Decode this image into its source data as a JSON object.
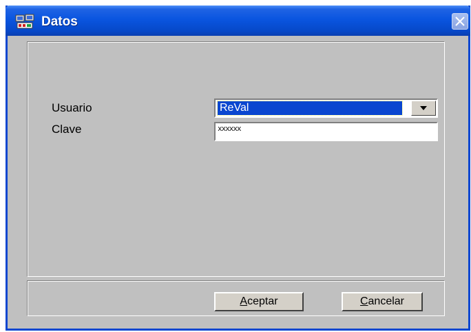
{
  "window": {
    "title": "Datos",
    "app_icon": "computer-network-icon",
    "close_icon": "close-icon",
    "titlebar_color": "#0a55e0",
    "frame_color": "#c0c0c0"
  },
  "form": {
    "usuario_label": "Usuario",
    "clave_label": "Clave",
    "usuario_value": "ReVal",
    "clave_value": "xxxxxx",
    "combo_arrow_icon": "chevron-down-icon",
    "selection_color": "#0a46d0"
  },
  "buttons": {
    "aceptar_mnemonic": "A",
    "aceptar_rest": "ceptar",
    "cancelar_mnemonic": "C",
    "cancelar_rest": "ancelar"
  }
}
